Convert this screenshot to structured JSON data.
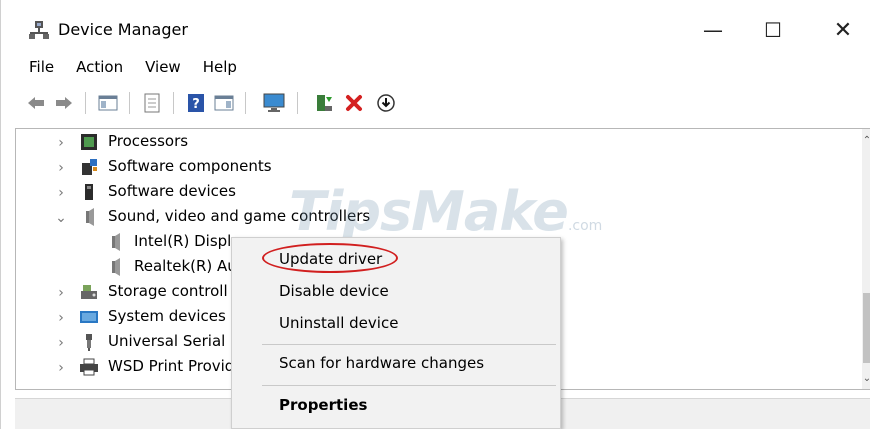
{
  "window": {
    "title": "Device Manager",
    "controls": {
      "minimize": "—",
      "maximize": "☐",
      "close": "✕"
    }
  },
  "menubar": {
    "items": [
      "File",
      "Action",
      "View",
      "Help"
    ]
  },
  "toolbar": {
    "icons": [
      "back-arrow-icon",
      "forward-arrow-icon",
      "show-hide-console-tree-icon",
      "properties-icon",
      "help-icon",
      "action-pane-icon",
      "monitor-icon",
      "update-driver-icon",
      "uninstall-icon",
      "download-icon"
    ]
  },
  "tree": {
    "rows": [
      {
        "label": "Processors",
        "icon": "processor-icon",
        "expander": "›"
      },
      {
        "label": "Software components",
        "icon": "software-components-icon",
        "expander": "›"
      },
      {
        "label": "Software devices",
        "icon": "software-devices-icon",
        "expander": "›"
      },
      {
        "label": "Sound, video and game controllers",
        "icon": "speaker-icon",
        "expander": "⌄"
      },
      {
        "label": "Intel(R) Displ",
        "icon": "speaker-icon",
        "expander": ""
      },
      {
        "label": "Realtek(R) Au",
        "icon": "speaker-icon",
        "expander": ""
      },
      {
        "label": "Storage controll",
        "icon": "storage-icon",
        "expander": "›"
      },
      {
        "label": "System devices",
        "icon": "system-devices-icon",
        "expander": "›"
      },
      {
        "label": "Universal Serial E",
        "icon": "usb-icon",
        "expander": "›"
      },
      {
        "label": "WSD Print Provid",
        "icon": "printer-icon",
        "expander": "›"
      }
    ],
    "scroll_up": "⌃",
    "scroll_down": "⌄"
  },
  "watermark": {
    "brand": "TipsMake",
    "suffix": ".com"
  },
  "context_menu": {
    "items": {
      "update": "Update driver",
      "disable": "Disable device",
      "uninstall": "Uninstall device",
      "scan": "Scan for hardware changes",
      "properties": "Properties"
    }
  },
  "colors": {
    "highlight_ring": "#d11f1f",
    "menu_bg": "#f2f2f2"
  }
}
